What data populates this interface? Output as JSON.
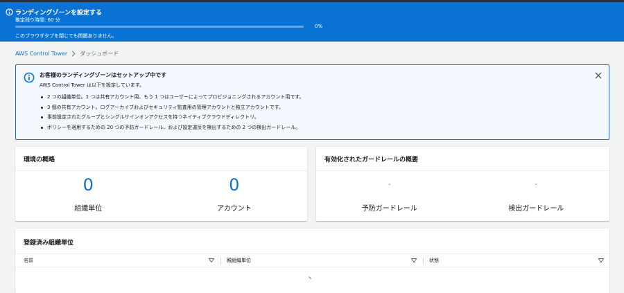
{
  "banner": {
    "title": "ランディングゾーンを設定する",
    "subtitle": "推定残り時間: 60 分",
    "progress_percent": 0,
    "percent_label": "0%",
    "note": "このブラウザタブを閉じても問題ありません。",
    "color": "#0972d3"
  },
  "breadcrumb": {
    "root": "AWS Control Tower",
    "current": "ダッシュボード"
  },
  "alert": {
    "title": "お客様のランディングゾーンはセットアップ中です",
    "description": "AWS Control Tower は以下を設定しています。",
    "items": [
      "2 つの組織単位。1 つは共有アカウント用、もう 1 つはユーザーによってプロビジョニングされるアカウント用です。",
      "3 個の共有アカウント。ログアーカイブおよびセキュリティ監査用の管理アカウントと独立アカウントです。",
      "事前設定されたグループとシングルサインオンアクセスを持つネイティブクラウドディレクトリ。",
      "ポリシーを適用するための 20 つの予防ガードレール、および設定違反を検出するための 2 つの検出ガードレール。"
    ]
  },
  "environment": {
    "title": "環境の概略",
    "ou_count": "0",
    "ou_label": "組織単位",
    "account_count": "0",
    "account_label": "アカウント"
  },
  "guardrails": {
    "title": "有効化されたガードレールの概要",
    "preventive_value": "-",
    "preventive_label": "予防ガードレール",
    "detective_value": "-",
    "detective_label": "検出ガードレール"
  },
  "registered_ou": {
    "title": "登録済み組織単位",
    "columns": [
      "名前",
      "親組織単位",
      "状態"
    ]
  },
  "icons": {
    "banner": "info-icon",
    "alert": "info-circle-icon",
    "close": "close-icon",
    "breadcrumb_separator": "chevron-right-icon",
    "sort": "caret-down-icon"
  }
}
